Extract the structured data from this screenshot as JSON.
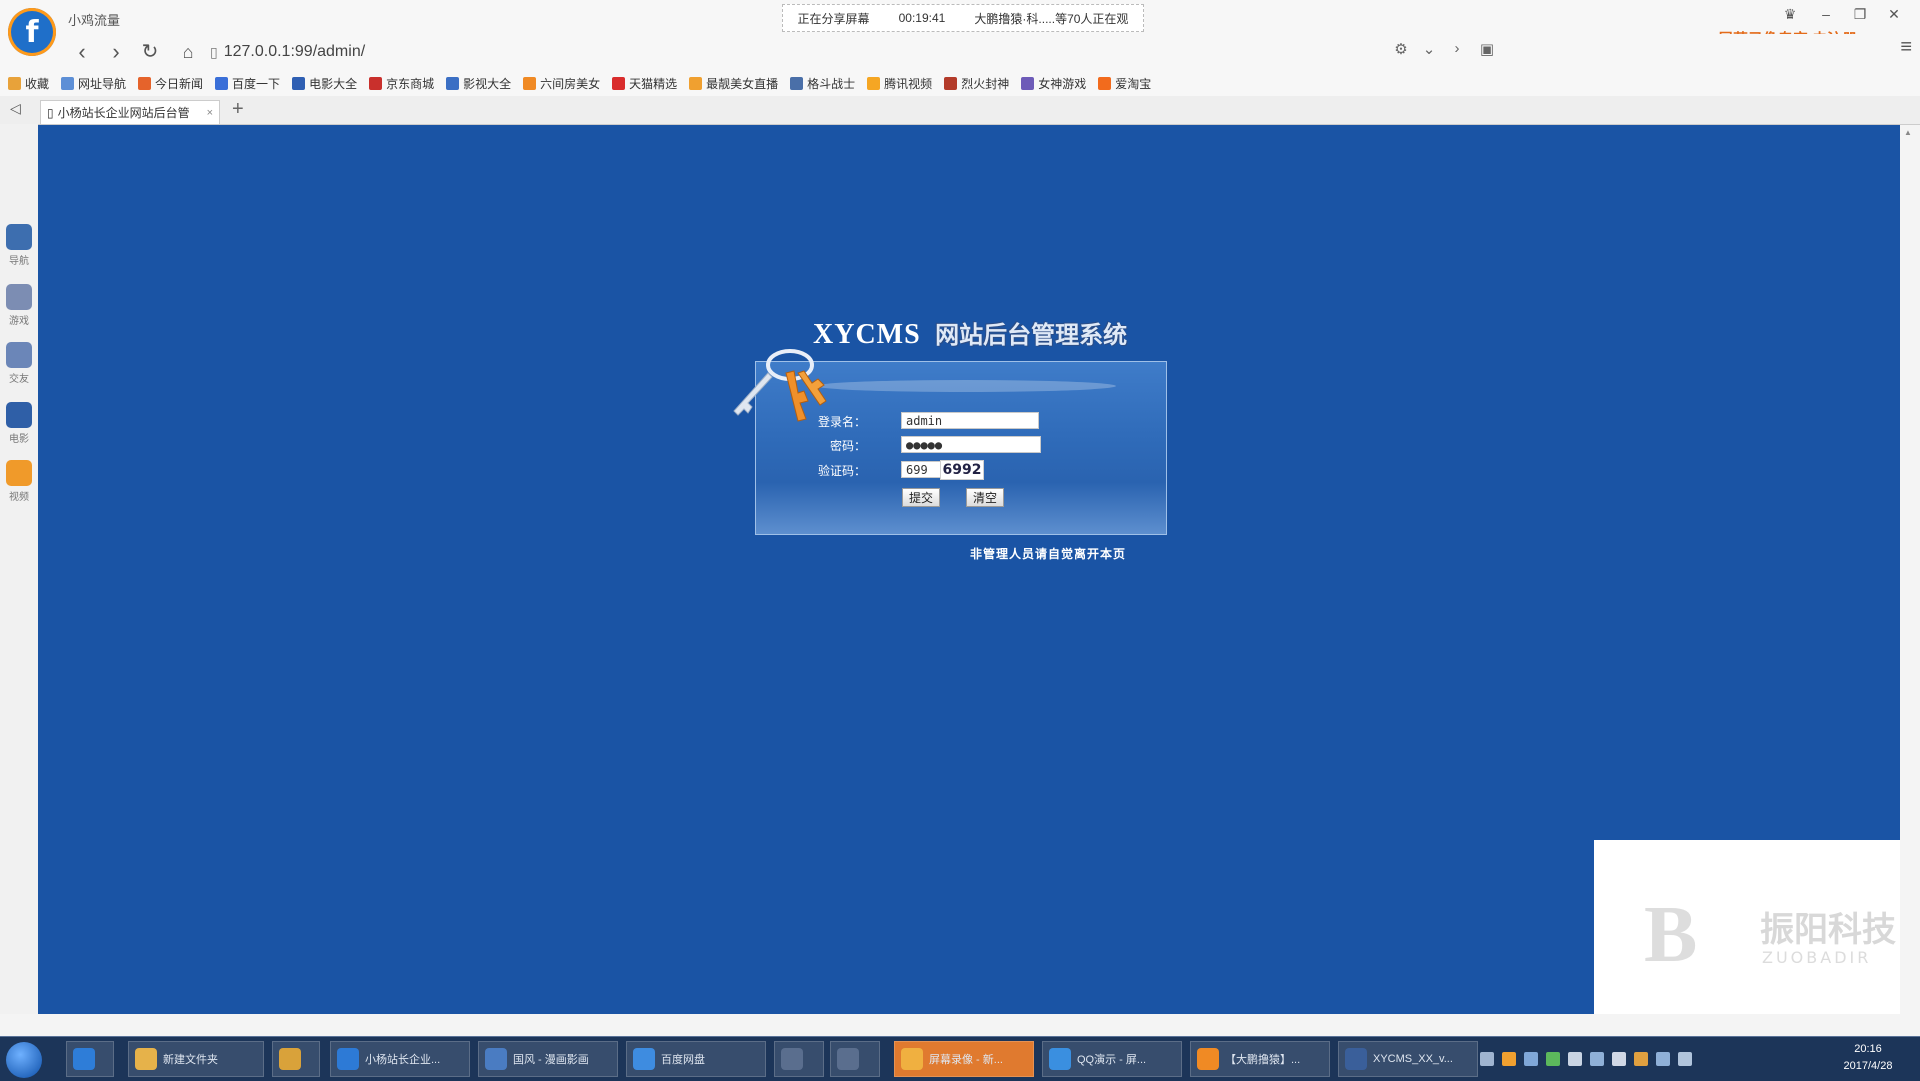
{
  "window": {
    "title": "小鸡流量"
  },
  "share_bar": {
    "status": "正在分享屏幕",
    "timer": "00:19:41",
    "viewers": "大鹏撸猿·科.....等70人正在观"
  },
  "recorder_brand": "屏幕录像专家 未注册",
  "address": {
    "url": "127.0.0.1:99/admin/"
  },
  "bookmarks": [
    {
      "label": "收藏",
      "color": "#e8a23a"
    },
    {
      "label": "网址导航",
      "color": "#5d8fd6"
    },
    {
      "label": "今日新闻",
      "color": "#e5632b"
    },
    {
      "label": "百度一下",
      "color": "#3a6fd8"
    },
    {
      "label": "电影大全",
      "color": "#2f5fb3"
    },
    {
      "label": "京东商城",
      "color": "#c9302c"
    },
    {
      "label": "影视大全",
      "color": "#3b6fc4"
    },
    {
      "label": "六间房美女",
      "color": "#f08a24"
    },
    {
      "label": "天猫精选",
      "color": "#d92c2c"
    },
    {
      "label": "最靓美女直播",
      "color": "#f0a030"
    },
    {
      "label": "格斗战士",
      "color": "#4a6fa8"
    },
    {
      "label": "腾讯视频",
      "color": "#f5a623"
    },
    {
      "label": "烈火封神",
      "color": "#b33b2a"
    },
    {
      "label": "女神游戏",
      "color": "#6d5bb8"
    },
    {
      "label": "爱淘宝",
      "color": "#f26b1d"
    }
  ],
  "tab": {
    "title": "小杨站长企业网站后台管",
    "close": "×",
    "new": "+"
  },
  "sidebar": [
    {
      "label": "导航",
      "color": "#3d6eaf"
    },
    {
      "label": "游戏",
      "color": "#7c8db3"
    },
    {
      "label": "交友",
      "color": "#6b86b8"
    },
    {
      "label": "电影",
      "color": "#2f5fa7"
    },
    {
      "label": "视频",
      "color": "#f09a2a"
    }
  ],
  "login": {
    "brand": "XYCMS",
    "subtitle": "网站后台管理系统",
    "username_label": "登录名：",
    "username_value": "admin",
    "password_label": "密码：",
    "password_value": "●●●●●",
    "captcha_label": "验证码：",
    "captcha_input": "699",
    "captcha_image": "6992",
    "submit": "提交",
    "reset": "清空",
    "notice": "非管理人员请自觉离开本页"
  },
  "watermark": {
    "logo": "B",
    "text": "振阳科技",
    "sub": "ZUOBADIR"
  },
  "taskbar": {
    "items": [
      {
        "label": "",
        "color": "#2e7dd8",
        "active": false
      },
      {
        "label": "新建文件夹",
        "color": "#e6b24a",
        "active": false
      },
      {
        "label": "",
        "color": "#d9a23a",
        "active": false
      },
      {
        "label": "小杨站长企业...",
        "color": "#2d7ad6",
        "active": false
      },
      {
        "label": "国风 - 漫画影画",
        "color": "#4a7cc2",
        "active": false
      },
      {
        "label": "百度网盘",
        "color": "#3e8ce0",
        "active": false
      },
      {
        "label": "",
        "color": "#5a6e8e",
        "active": false
      },
      {
        "label": "",
        "color": "#5a6e8e",
        "active": false
      },
      {
        "label": "屏幕录像 - 新...",
        "color": "#f0b040",
        "active": true
      },
      {
        "label": "QQ演示 - 屏...",
        "color": "#3a8fe0",
        "active": false
      },
      {
        "label": "【大鹏撸猿】...",
        "color": "#f08a24",
        "active": false
      },
      {
        "label": "XYCMS_XX_v...",
        "color": "#3a5f9a",
        "active": false
      }
    ],
    "time": "20:16",
    "date": "2017/4/28"
  }
}
